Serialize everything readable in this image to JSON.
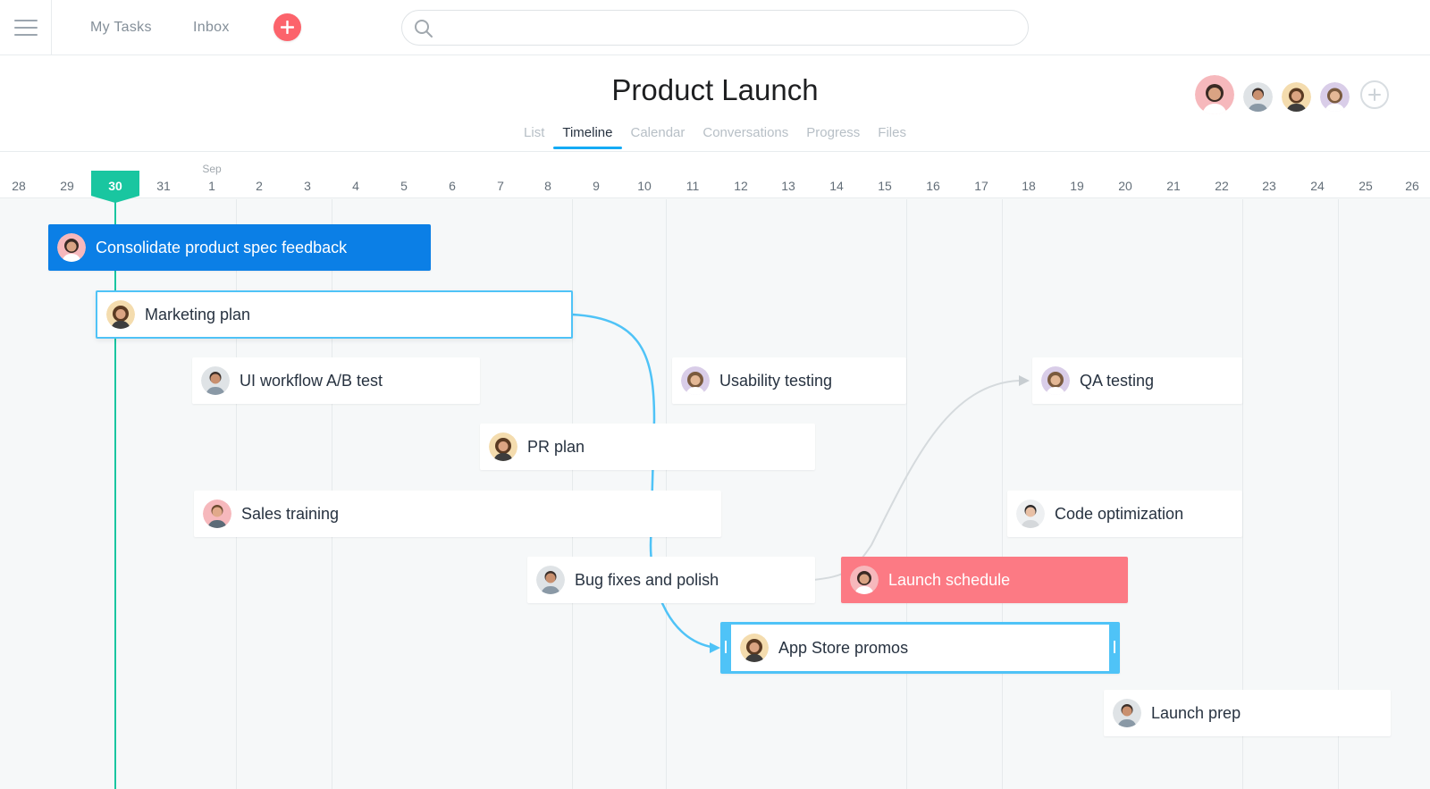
{
  "topbar": {
    "menu_icon": "hamburger-icon",
    "nav": [
      "My Tasks",
      "Inbox"
    ],
    "add_icon": "plus-icon",
    "search_icon": "search-icon",
    "search_value": ""
  },
  "project": {
    "title": "Product Launch",
    "tabs": [
      "List",
      "Timeline",
      "Calendar",
      "Conversations",
      "Progress",
      "Files"
    ],
    "active_tab": "Timeline",
    "add_member_icon": "plus-circle-icon"
  },
  "timeline": {
    "month_label": "Sep",
    "dates": [
      "28",
      "29",
      "30",
      "31",
      "1",
      "2",
      "3",
      "4",
      "5",
      "6",
      "7",
      "8",
      "9",
      "10",
      "11",
      "12",
      "13",
      "14",
      "15",
      "16",
      "17",
      "18",
      "19",
      "20",
      "21",
      "22",
      "23",
      "24",
      "25",
      "26"
    ],
    "today": "30"
  },
  "tasks": [
    {
      "label": "Consolidate product spec feedback",
      "style": "highlighted"
    },
    {
      "label": "Marketing plan",
      "style": "selected"
    },
    {
      "label": "UI workflow A/B test",
      "style": "default"
    },
    {
      "label": "Usability testing",
      "style": "default"
    },
    {
      "label": "QA testing",
      "style": "default"
    },
    {
      "label": "PR plan",
      "style": "default"
    },
    {
      "label": "Sales training",
      "style": "default"
    },
    {
      "label": "Code optimization",
      "style": "default"
    },
    {
      "label": "Bug fixes and polish",
      "style": "default"
    },
    {
      "label": "Launch schedule",
      "style": "alert"
    },
    {
      "label": "App Store promos",
      "style": "dragging"
    },
    {
      "label": "Launch prep",
      "style": "default"
    }
  ],
  "colors": {
    "accent": "#14aaf5",
    "today": "#19c6a0",
    "highlight_task": "#0b7fe6",
    "alert_task": "#fc7a84",
    "add_button": "#fc636b"
  }
}
